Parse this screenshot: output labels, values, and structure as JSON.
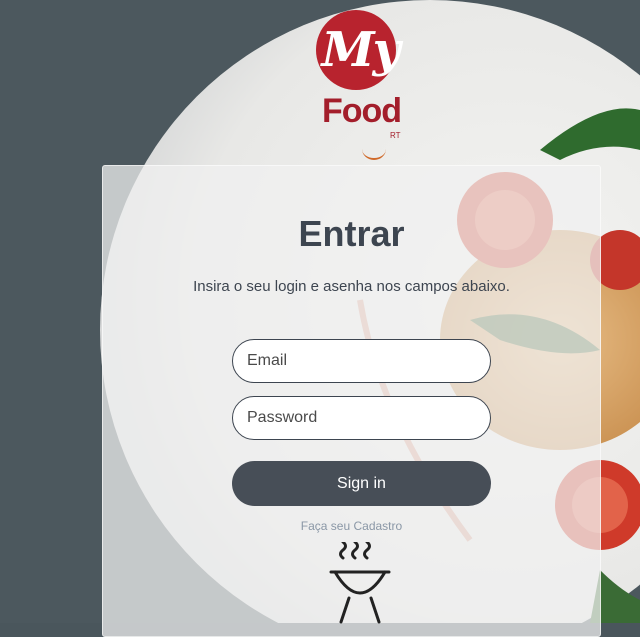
{
  "logo": {
    "my": "My",
    "food": "Food",
    "rt": "RT"
  },
  "login": {
    "title": "Entrar",
    "subtitle": "Insira o seu login e asenha nos campos abaixo.",
    "email_placeholder": "Email",
    "password_placeholder": "Password",
    "signin_label": "Sign in",
    "register_link": "Faça seu Cadastro"
  },
  "icons": {
    "logo": "myfood-logo",
    "grill": "grill-icon"
  },
  "colors": {
    "accent": "#474e57",
    "brand": "#b8232e",
    "text": "#3d4550"
  }
}
